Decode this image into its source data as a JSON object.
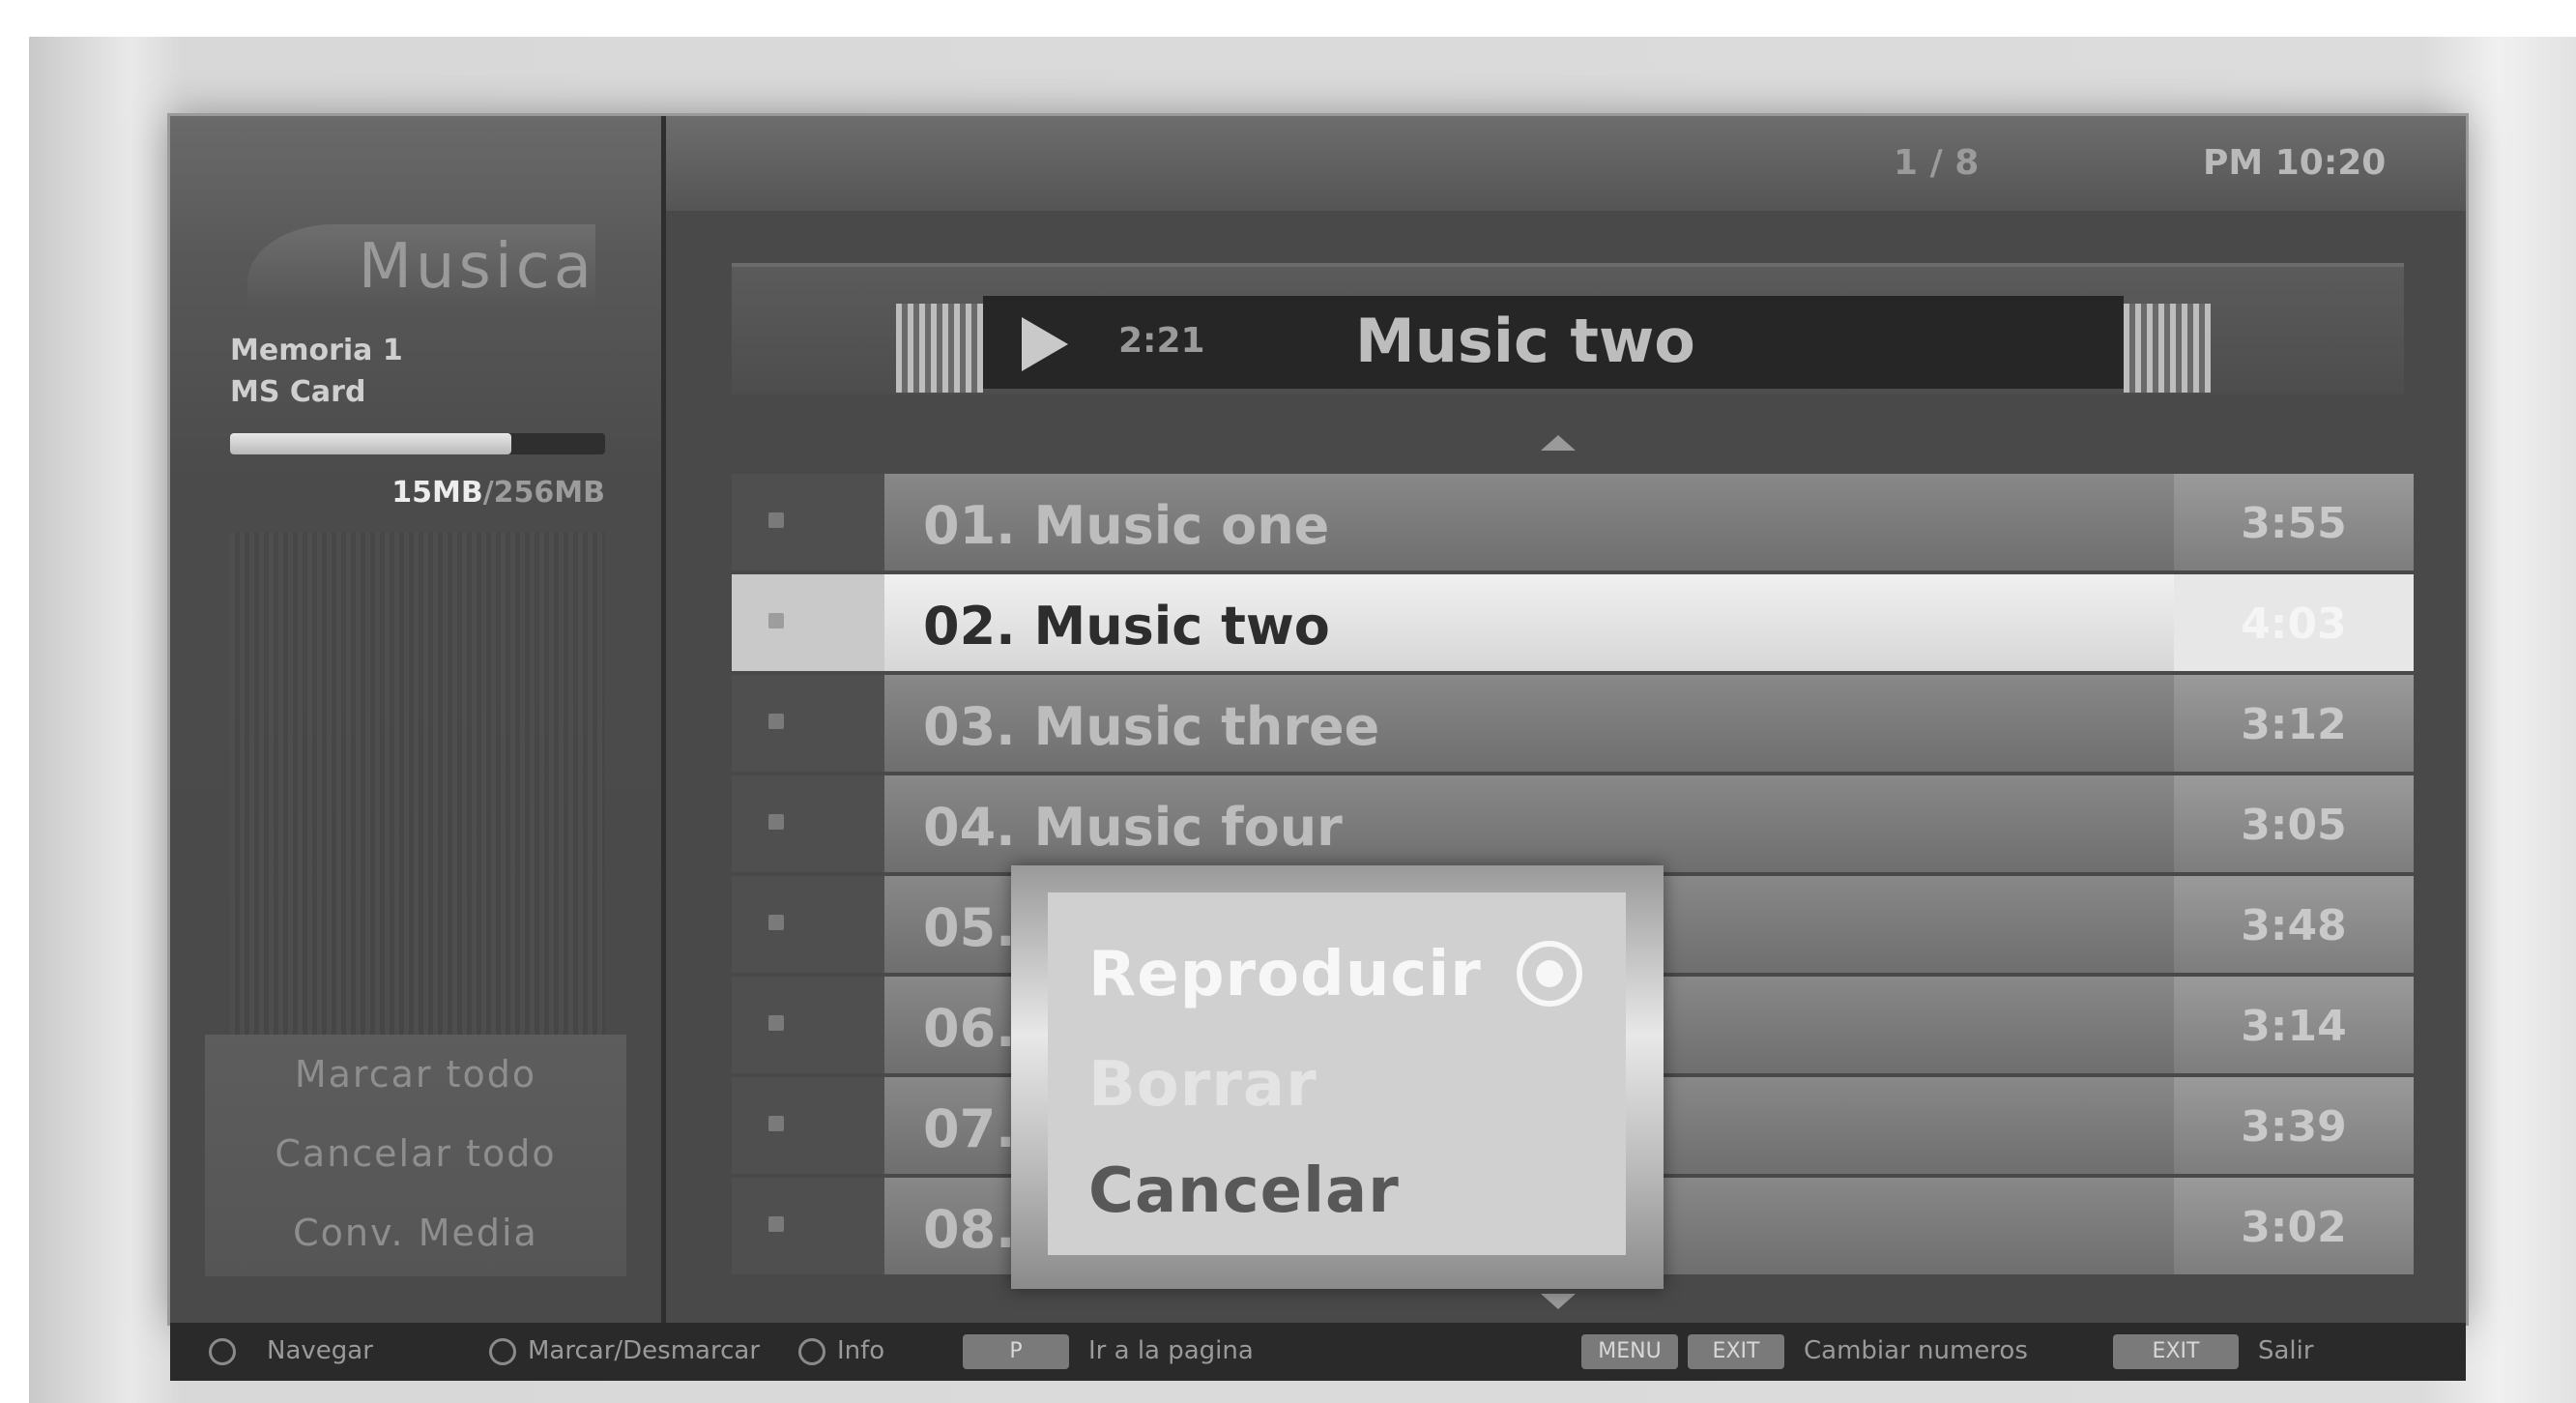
{
  "left_panel": {
    "section_title": "Musica",
    "device_name": "Memoria 1",
    "device_type": "MS Card",
    "capacity_used": "15MB",
    "capacity_total": "256MB",
    "capacity_fraction": 0.75,
    "actions": [
      "Marcar todo",
      "Cancelar todo",
      "Conv. Media"
    ]
  },
  "topbar": {
    "page_indicator": "1 / 8",
    "clock": "PM 10:20"
  },
  "now_playing": {
    "time": "2:21",
    "title": "Music two"
  },
  "tracks": [
    {
      "title": "01. Music one",
      "time": "3:55",
      "selected": false
    },
    {
      "title": "02. Music two",
      "time": "4:03",
      "selected": true
    },
    {
      "title": "03. Music three",
      "time": "3:12",
      "selected": false
    },
    {
      "title": "04. Music four",
      "time": "3:05",
      "selected": false
    },
    {
      "title": "05. Music five",
      "time": "3:48",
      "selected": false
    },
    {
      "title": "06. Music six",
      "time": "3:14",
      "selected": false
    },
    {
      "title": "07. Music seven",
      "time": "3:39",
      "selected": false
    },
    {
      "title": "08. Music eight",
      "time": "3:02",
      "selected": false
    }
  ],
  "popup": {
    "play_label": "Reproducir",
    "delete_label": "Borrar",
    "cancel_label": "Cancelar"
  },
  "bottom_bar": {
    "navigate": "Navegar",
    "mark": "Marcar/Desmarcar",
    "info": "Info",
    "page_key": "P",
    "page_label": "Ir a la pagina",
    "key1": "MENU",
    "key2": "EXIT",
    "change_label": "Cambiar numeros",
    "exit_key": "EXIT",
    "exit_label": "Salir"
  },
  "colors": {
    "panel_dark": "#3a3a3a",
    "selected_row": "#e8e8e8",
    "popup_bg": "#d0d0d0"
  }
}
